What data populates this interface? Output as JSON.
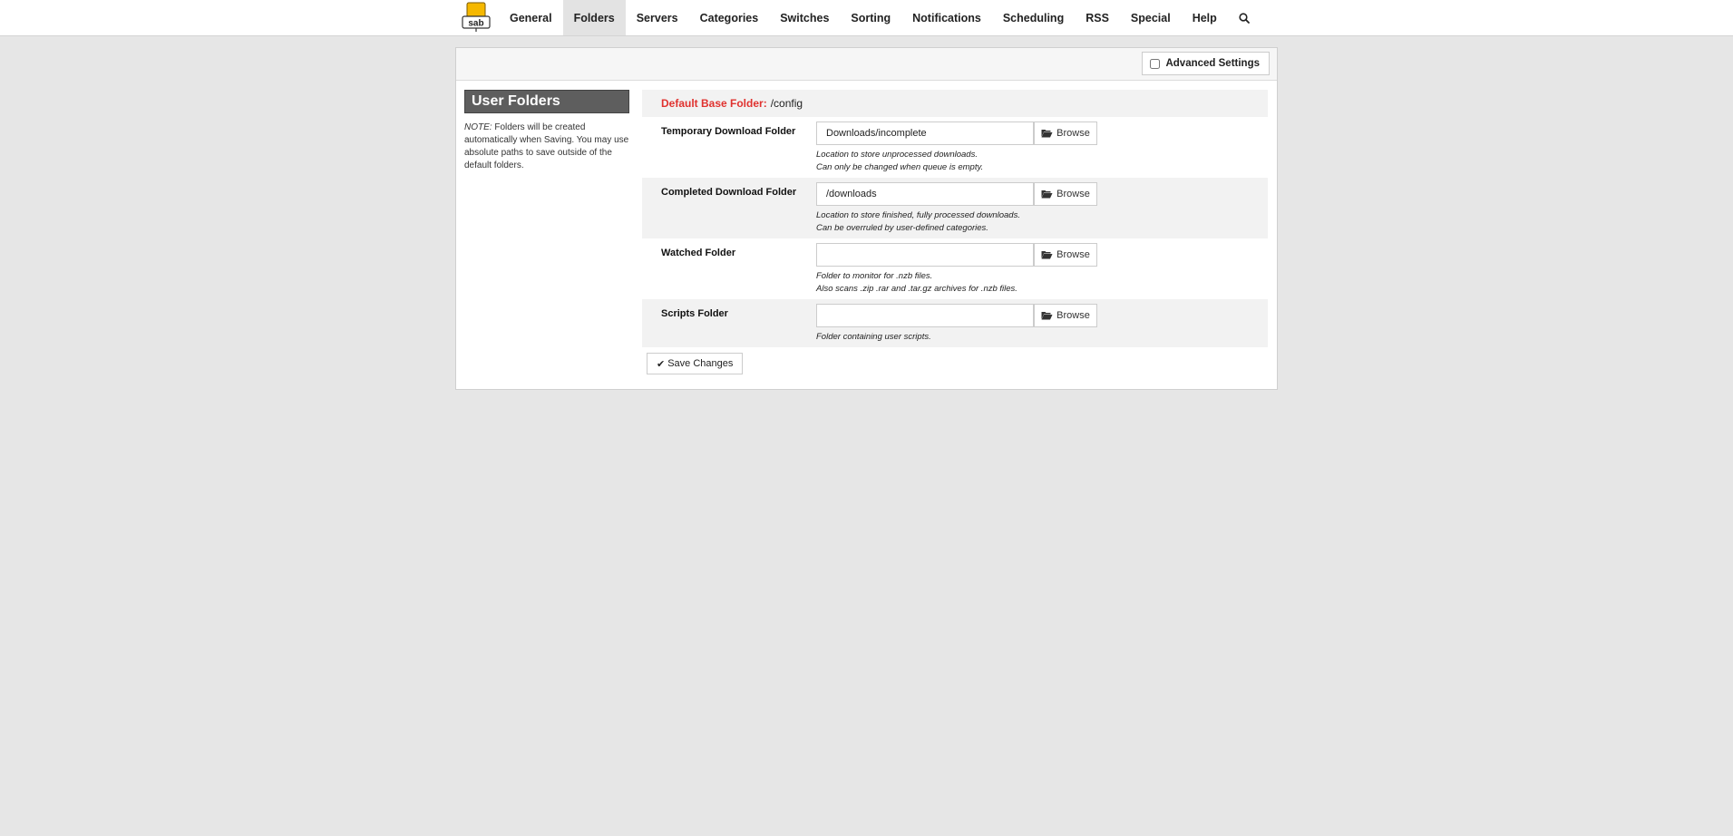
{
  "nav": {
    "items": [
      {
        "label": "General"
      },
      {
        "label": "Folders",
        "active": true
      },
      {
        "label": "Servers"
      },
      {
        "label": "Categories"
      },
      {
        "label": "Switches"
      },
      {
        "label": "Sorting"
      },
      {
        "label": "Notifications"
      },
      {
        "label": "Scheduling"
      },
      {
        "label": "RSS"
      },
      {
        "label": "Special"
      },
      {
        "label": "Help"
      }
    ],
    "search_icon": "search-icon",
    "logo_text": "sab"
  },
  "header": {
    "advanced_label": "Advanced Settings",
    "advanced_checked": false
  },
  "sidebar": {
    "title": "User Folders",
    "note_prefix": "NOTE:",
    "note_text": " Folders will be created automatically when Saving. You may use absolute paths to save outside of the default folders."
  },
  "base": {
    "label": "Default Base Folder:",
    "value": "/config"
  },
  "folders": [
    {
      "label": "Temporary Download Folder",
      "value": "Downloads/incomplete",
      "help1": "Location to store unprocessed downloads.",
      "help2": "Can only be changed when queue is empty.",
      "browse": "Browse"
    },
    {
      "label": "Completed Download Folder",
      "value": "/downloads",
      "help1": "Location to store finished, fully processed downloads.",
      "help2": "Can be overruled by user-defined categories.",
      "browse": "Browse"
    },
    {
      "label": "Watched Folder",
      "value": "",
      "help1": "Folder to monitor for .nzb files.",
      "help2": "Also scans .zip .rar and .tar.gz archives for .nzb files.",
      "browse": "Browse"
    },
    {
      "label": "Scripts Folder",
      "value": "",
      "help1": "Folder containing user scripts.",
      "help2": "",
      "browse": "Browse"
    }
  ],
  "save_label": "Save Changes",
  "colors": {
    "accent_red": "#e0322f",
    "sidebar_title_bg": "#5e5e5e",
    "page_bg": "#e6e6e6"
  }
}
